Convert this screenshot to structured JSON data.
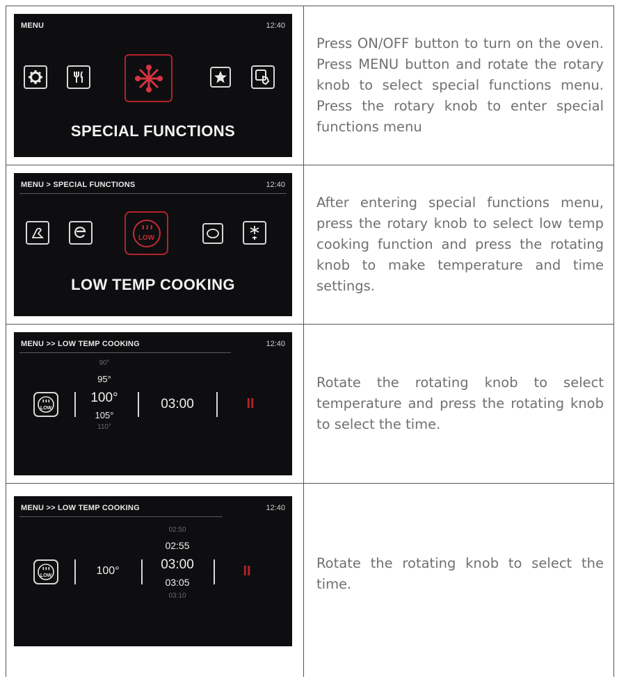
{
  "steps": [
    {
      "screen": {
        "header": "MENU",
        "clock": "12:40",
        "title": "SPECIAL FUNCTIONS",
        "icons": [
          "gear-icon",
          "cutlery-icon",
          "snowflake-icon",
          "star-icon",
          "touch-icon"
        ]
      },
      "description": "Press ON/OFF button to turn on the oven. Press MENU button and rotate the rotary knob to select special functions menu. Press the rotary knob to enter special functions menu"
    },
    {
      "screen": {
        "header": "MENU > SPECIAL FUNCTIONS",
        "clock": "12:40",
        "title": "LOW TEMP COOKING",
        "icons": [
          "dough-icon",
          "eco-icon",
          "low-temp-icon",
          "oval-icon",
          "defrost-icon"
        ],
        "low_label": "LOW"
      },
      "description": "After entering special functions menu, press the rotary knob to select low temp cooking function and press the rotating knob to make temperature and time settings."
    },
    {
      "screen": {
        "header": "MENU >> LOW TEMP COOKING",
        "clock": "12:40",
        "low_label": "LOW",
        "temps": [
          "90°",
          "95°",
          "100°",
          "105°",
          "110°"
        ],
        "time": "03:00",
        "pause": "II"
      },
      "description": "Rotate the rotating knob to select temperature and press the rotating knob to select the time."
    },
    {
      "screen": {
        "header": "MENU >> LOW TEMP COOKING",
        "clock": "12:40",
        "low_label": "LOW",
        "temp": "100°",
        "times": [
          "02:50",
          "02:55",
          "03:00",
          "03:05",
          "03:10"
        ],
        "pause": "II"
      },
      "description": "Rotate the rotating knob to select the time."
    }
  ],
  "colors": {
    "accent": "#b4222b",
    "screen_bg": "#0e0e10",
    "text": "#707070"
  }
}
